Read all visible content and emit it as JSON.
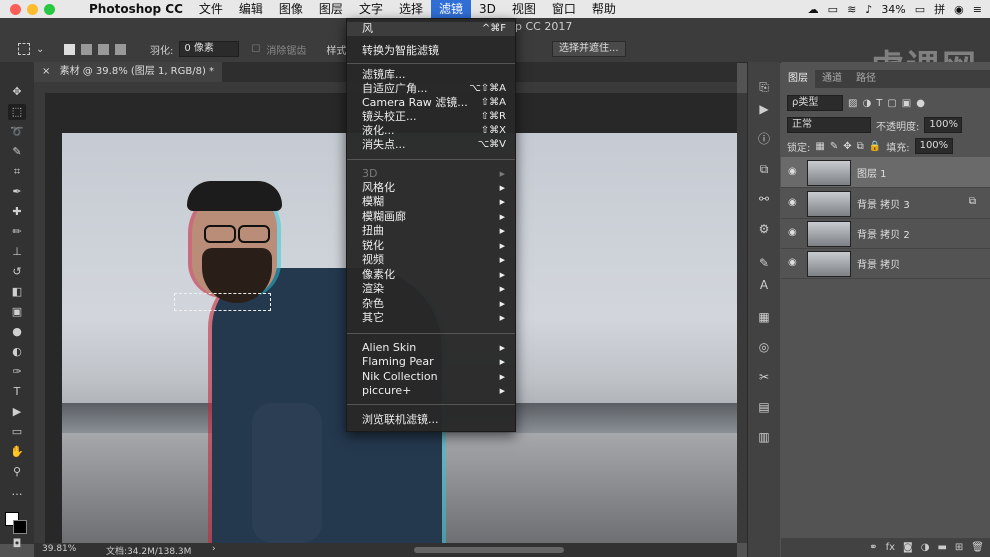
{
  "menubar": {
    "app_name": "Photoshop CC",
    "items": [
      "文件",
      "编辑",
      "图像",
      "图层",
      "文字",
      "选择",
      "滤镜",
      "3D",
      "视图",
      "窗口",
      "帮助"
    ],
    "active": "滤镜",
    "battery": "34%",
    "colors": {
      "active_bg": "#2f6fd6"
    }
  },
  "window_title": "p CC 2017",
  "watermark": "虎课网",
  "options": {
    "feather_label": "羽化:",
    "feather_value": "0 像素",
    "antialias_label": "消除锯齿",
    "style_label": "样式:",
    "select_mask_button": "选择并遮住..."
  },
  "document_tab": "素材 @ 39.8% (图层 1, RGB/8) *",
  "status": {
    "zoom": "39.81%",
    "doc_size": "文档:34.2M/138.3M"
  },
  "filter_menu": {
    "top": [
      {
        "label": "风",
        "shortcut": "^⌘F"
      },
      {
        "label": "转换为智能滤镜",
        "shortcut": ""
      }
    ],
    "group1": [
      {
        "label": "滤镜库...",
        "shortcut": ""
      },
      {
        "label": "自适应广角...",
        "shortcut": "⌥⇧⌘A"
      },
      {
        "label": "Camera Raw 滤镜...",
        "shortcut": "⇧⌘A"
      },
      {
        "label": "镜头校正...",
        "shortcut": "⇧⌘R"
      },
      {
        "label": "液化...",
        "shortcut": "⇧⌘X"
      },
      {
        "label": "消失点...",
        "shortcut": "⌥⌘V"
      }
    ],
    "group2": [
      {
        "label": "3D",
        "disabled": true
      },
      {
        "label": "风格化"
      },
      {
        "label": "模糊"
      },
      {
        "label": "模糊画廊"
      },
      {
        "label": "扭曲"
      },
      {
        "label": "锐化"
      },
      {
        "label": "视频"
      },
      {
        "label": "像素化"
      },
      {
        "label": "渲染"
      },
      {
        "label": "杂色"
      },
      {
        "label": "其它"
      }
    ],
    "group3": [
      {
        "label": "Alien Skin"
      },
      {
        "label": "Flaming Pear"
      },
      {
        "label": "Nik Collection"
      },
      {
        "label": "piccure+"
      }
    ],
    "bottom": [
      {
        "label": "浏览联机滤镜..."
      }
    ]
  },
  "layers_panel": {
    "tabs": [
      "图层",
      "通道",
      "路径"
    ],
    "active_tab": "图层",
    "kind_label": "ρ类型",
    "blend_mode": "正常",
    "opacity_label": "不透明度:",
    "opacity_value": "100%",
    "lock_label": "锁定:",
    "fill_label": "填充:",
    "fill_value": "100%",
    "layers": [
      {
        "name": "图层 1",
        "selected": true
      },
      {
        "name": "背景 拷贝 3",
        "selected": false
      },
      {
        "name": "背景 拷贝 2",
        "selected": false
      },
      {
        "name": "背景 拷贝",
        "selected": false
      }
    ],
    "bottom_icons": [
      "link-icon",
      "fx-icon",
      "mask-icon",
      "adjustment-icon",
      "group-icon",
      "new-layer-icon",
      "trash-icon"
    ]
  }
}
